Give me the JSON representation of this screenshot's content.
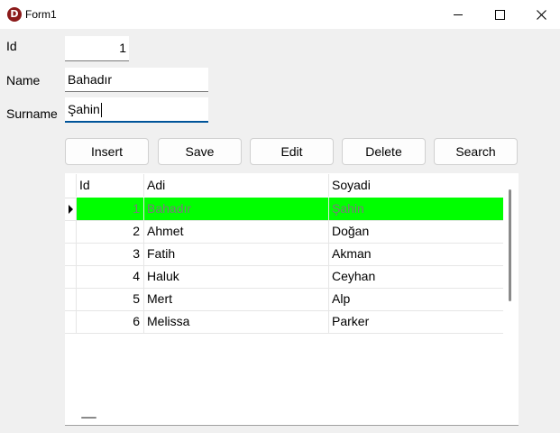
{
  "window": {
    "title": "Form1",
    "icon_glyph": "D",
    "controls": [
      "minimize-icon",
      "maximize-icon",
      "close-icon"
    ]
  },
  "form": {
    "id_label": "Id",
    "id_value": "1",
    "name_label": "Name",
    "name_value": "Bahadır",
    "surname_label": "Surname",
    "surname_value": "Şahin"
  },
  "buttons": {
    "insert": "Insert",
    "save": "Save",
    "edit": "Edit",
    "delete": "Delete",
    "search": "Search"
  },
  "grid": {
    "columns": [
      "Id",
      "Adi",
      "Soyadi"
    ],
    "rows": [
      {
        "id": "1",
        "adi": "Bahadır",
        "soyadi": "Şahin"
      },
      {
        "id": "2",
        "adi": "Ahmet",
        "soyadi": "Doğan"
      },
      {
        "id": "3",
        "adi": "Fatih",
        "soyadi": "Akman"
      },
      {
        "id": "4",
        "adi": "Haluk",
        "soyadi": "Ceyhan"
      },
      {
        "id": "5",
        "adi": "Mert",
        "soyadi": "Alp"
      },
      {
        "id": "6",
        "adi": "Melissa",
        "soyadi": "Parker"
      }
    ],
    "selected_row_color": "#00ff00",
    "selected_text_color": "#7a7a7a"
  },
  "colors": {
    "focus_underline": "#005499",
    "app_icon": "#8b1a1a"
  }
}
